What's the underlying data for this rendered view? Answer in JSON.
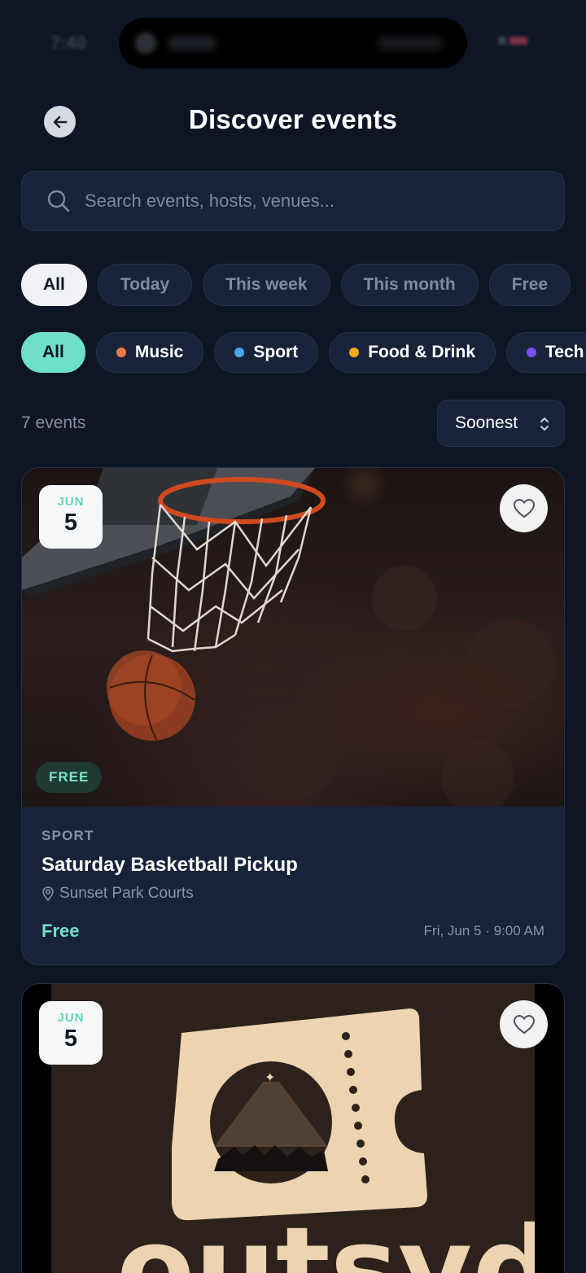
{
  "status_bar": {
    "time": "7:40"
  },
  "header": {
    "title": "Discover events"
  },
  "search": {
    "placeholder": "Search events, hosts, venues..."
  },
  "time_filters": [
    {
      "label": "All",
      "active": true
    },
    {
      "label": "Today",
      "active": false
    },
    {
      "label": "This week",
      "active": false
    },
    {
      "label": "This month",
      "active": false
    },
    {
      "label": "Free",
      "active": false
    }
  ],
  "category_filters": [
    {
      "label": "All",
      "active": true,
      "color": "#6fe0c8"
    },
    {
      "label": "Music",
      "active": false,
      "color": "#f07a45"
    },
    {
      "label": "Sport",
      "active": false,
      "color": "#4aa8ea"
    },
    {
      "label": "Food & Drink",
      "active": false,
      "color": "#f5a623"
    },
    {
      "label": "Tech",
      "active": false,
      "color": "#7c4dff"
    }
  ],
  "results": {
    "count_label": "7 events",
    "sort_label": "Soonest"
  },
  "events": [
    {
      "date_month": "JUN",
      "date_day": "5",
      "badge": "FREE",
      "category": "SPORT",
      "title": "Saturday Basketball Pickup",
      "venue": "Sunset Park Courts",
      "price": "Free",
      "when": "Fri, Jun 5 · 9:00 AM",
      "image": "basketball-hoop-photo"
    },
    {
      "date_month": "JUN",
      "date_day": "5",
      "logo_text": "outsyd",
      "image": "outsyd-ticket-logo"
    }
  ],
  "colors": {
    "background": "#0e1524",
    "surface": "#18233a",
    "accent": "#6fe0c8",
    "muted_text": "#8590a6"
  },
  "icons": [
    "back-arrow-icon",
    "search-icon",
    "heart-icon",
    "location-pin-icon",
    "sort-chevron-icon"
  ]
}
